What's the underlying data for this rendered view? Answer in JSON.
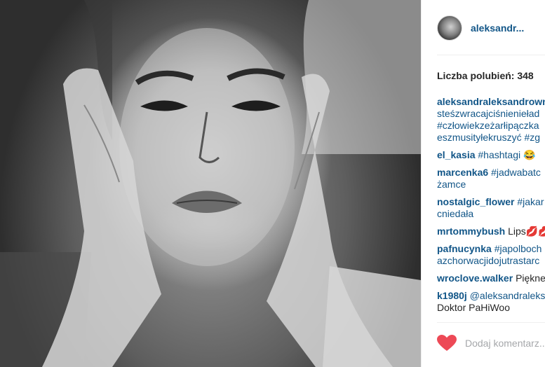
{
  "post": {
    "username": "aleksandr...",
    "likes": "Liczba polubień: 348",
    "add_comment_placeholder": "Dodaj komentarz..."
  },
  "colors": {
    "link": "#125688",
    "follow_button": "#70c050",
    "heart": "#ed4956"
  },
  "icons": {
    "like": "heart-icon"
  },
  "comments": [
    {
      "user": "aleksandraleksandrowna",
      "lines": [
        "steśzwracajciśnienieład",
        "#człowiekzeżarłipączka",
        "eszmusityłekruszyć #zg"
      ]
    },
    {
      "user": "el_kasia",
      "text": "#hashtagi 😂"
    },
    {
      "user": "marcenka6",
      "text": "#jadwabatc",
      "lines": [
        "żamce"
      ]
    },
    {
      "user": "nostalgic_flower",
      "text": "#jakar",
      "lines": [
        "cniedała"
      ]
    },
    {
      "user": "mrtommybush",
      "text_plain": "Lips💋💋"
    },
    {
      "user": "pafnucynka",
      "text": "#japolboch",
      "lines": [
        "azchorwacjidojutrastarc"
      ]
    },
    {
      "user": "wroclove.walker",
      "text_plain": "Piękne"
    },
    {
      "user": "k1980j",
      "text": "@aleksandraleks",
      "lines_plain": [
        "Doktor PaHiWoo"
      ]
    }
  ]
}
